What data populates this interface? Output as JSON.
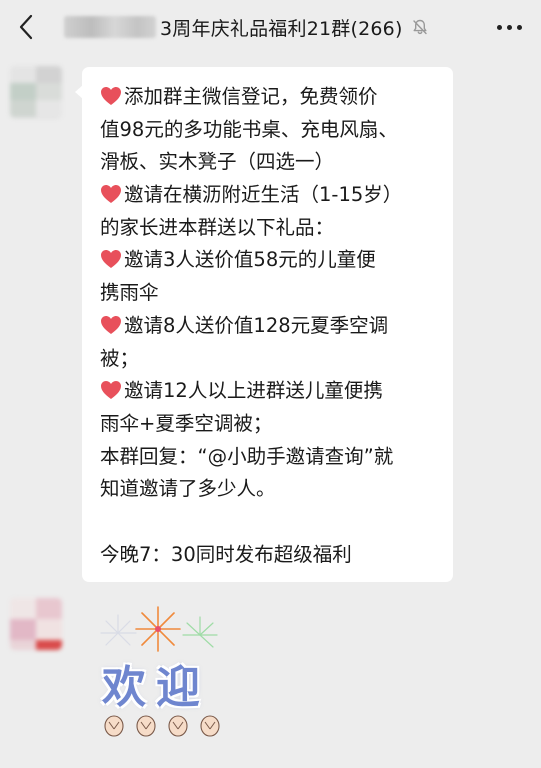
{
  "header": {
    "title": "3周年庆礼品福利21群(266)",
    "back_icon": "chevron-left-icon",
    "mute_icon": "bell-off-icon",
    "more_icon": "more-dots-icon"
  },
  "message": {
    "lines": [
      "添加群主微信登记，免费领价",
      "值98元的多功能书桌、充电风扇、",
      "滑板、实木凳子（四选一）",
      "邀请在横沥附近生活（1-15岁）",
      "的家长进本群送以下礼品：",
      "邀请3人送价值58元的儿童便",
      "携雨伞",
      "邀请8人送价值128元夏季空调",
      "被；",
      "邀请12人以上进群送儿童便携",
      "雨伞+夏季空调被；",
      "本群回复：“@小助手邀请查询”就",
      "知道邀请了多少人。",
      "今晚7：30同时发布超级福利"
    ],
    "heart_color": "#e8505b"
  },
  "sticker": {
    "text": "欢迎",
    "text_color": "#6f86cf"
  },
  "colors": {
    "background": "#ededed",
    "bubble": "#ffffff",
    "text": "#1a1a1a"
  }
}
